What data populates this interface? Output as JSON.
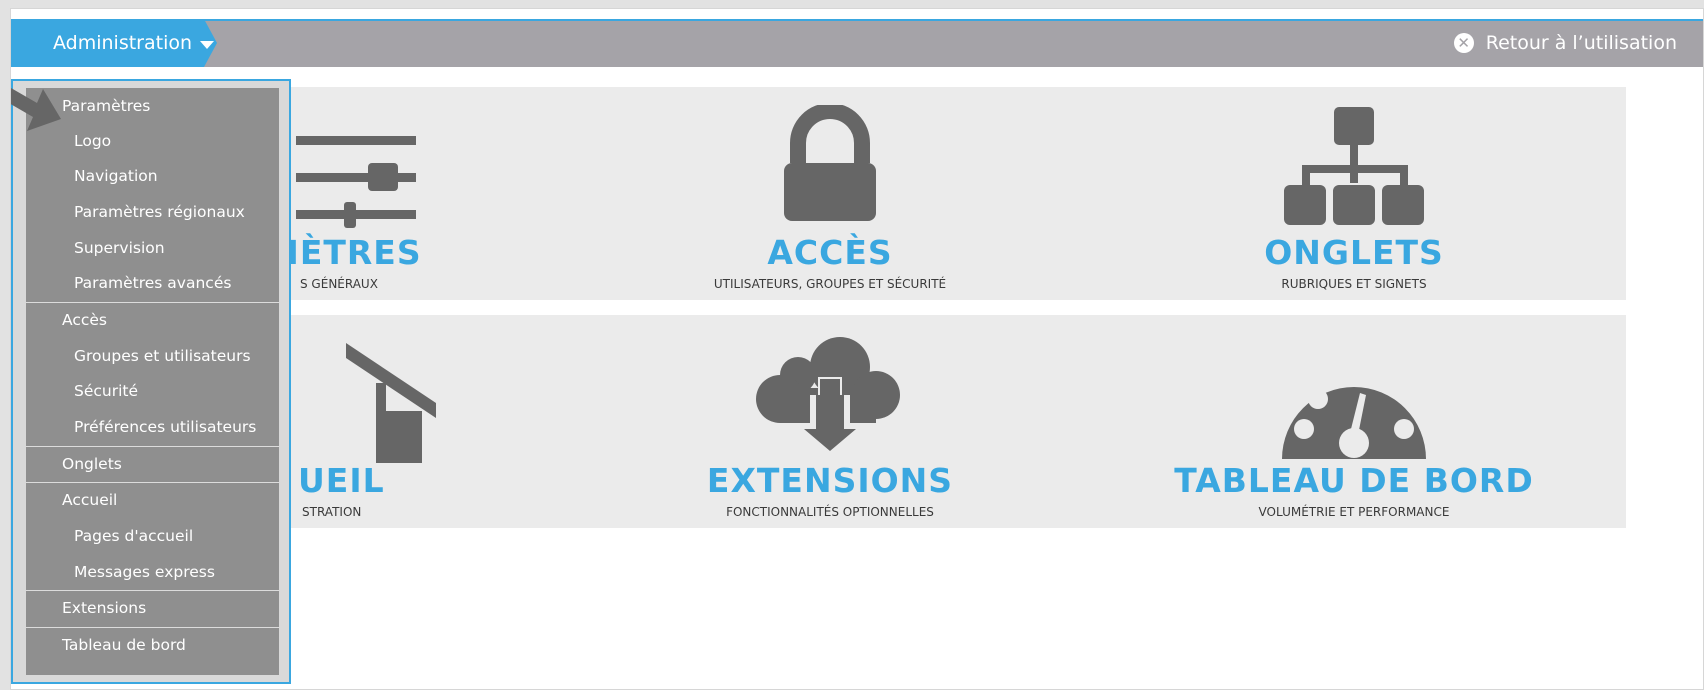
{
  "topbar": {
    "admin_label": "Administration",
    "return_label": "Retour à l’utilisation"
  },
  "tiles": [
    {
      "title": "PARAMÈTRES",
      "visible_title": "MÈTRES",
      "subtitle": "S GÉNÉRAUX",
      "icon": "sliders-icon"
    },
    {
      "title": "ACCÈS",
      "subtitle": "UTILISATEURS, GROUPES ET SÉCURITÉ",
      "icon": "lock-icon"
    },
    {
      "title": "ONGLETS",
      "subtitle": "RUBRIQUES ET SIGNETS",
      "icon": "sitemap-icon"
    },
    {
      "title": "ACCUEIL",
      "visible_title": "UEIL",
      "subtitle": "STRATION",
      "icon": "home-icon"
    },
    {
      "title": "EXTENSIONS",
      "subtitle": "FONCTIONNALITÉS OPTIONNELLES",
      "icon": "cloud-download-icon"
    },
    {
      "title": "TABLEAU DE BORD",
      "subtitle": "VOLUMÉTRIE ET PERFORMANCE",
      "icon": "dashboard-icon"
    }
  ],
  "menu": {
    "items": [
      {
        "label": "Paramètres"
      },
      {
        "label": "Logo"
      },
      {
        "label": "Navigation"
      },
      {
        "label": "Paramètres régionaux"
      },
      {
        "label": "Supervision"
      },
      {
        "label": "Paramètres avancés"
      },
      {
        "label": "Accès"
      },
      {
        "label": "Groupes et utilisateurs"
      },
      {
        "label": "Sécurité"
      },
      {
        "label": "Préférences utilisateurs"
      },
      {
        "label": "Onglets"
      },
      {
        "label": "Accueil"
      },
      {
        "label": "Pages d'accueil"
      },
      {
        "label": "Messages express"
      },
      {
        "label": "Extensions"
      },
      {
        "label": "Tableau de bord"
      }
    ]
  },
  "colors": {
    "accent": "#3aa7e0",
    "topbar": "#a5a3a8",
    "tile_bg": "#ebebeb",
    "icon": "#666666",
    "menu_bg": "#8f8f8f"
  }
}
